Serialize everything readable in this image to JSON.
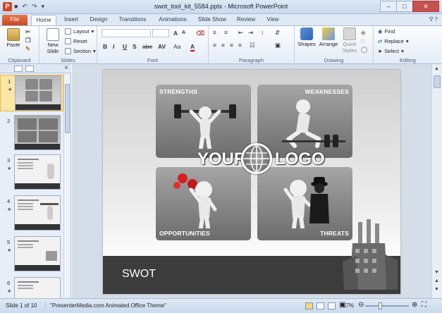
{
  "window": {
    "title": "swot_tool_kit_5584.pptx - Microsoft PowerPoint",
    "app_icon_letter": "P",
    "controls": {
      "minimize": "–",
      "maximize": "□",
      "close": "✕"
    }
  },
  "ribbon_tabs": [
    "File",
    "Home",
    "Insert",
    "Design",
    "Transitions",
    "Animations",
    "Slide Show",
    "Review",
    "View"
  ],
  "active_tab": "Home",
  "ribbon_tab_right": "∇ ?",
  "groups": {
    "clipboard": {
      "label": "Clipboard",
      "paste": "Paste"
    },
    "slides": {
      "label": "Slides",
      "new_slide": "New Slide",
      "layout": "Layout",
      "reset": "Reset",
      "section": "Section"
    },
    "font": {
      "label": "Font",
      "bold": "B",
      "italic": "I",
      "underline": "U",
      "strike": "S",
      "abc": "abe",
      "spacing": "AV",
      "case": "Aa",
      "color": "A",
      "grow": "A",
      "shrink": "A"
    },
    "paragraph": {
      "label": "Paragraph"
    },
    "drawing": {
      "label": "Drawing",
      "shapes": "Shapes",
      "arrange": "Arrange",
      "quick_styles": "Quick Styles"
    },
    "editing": {
      "label": "Editing",
      "find": "Find",
      "replace": "Replace",
      "select": "Select"
    }
  },
  "slide_panel": {
    "thumbnails": [
      {
        "num": "1",
        "selected": true
      },
      {
        "num": "2",
        "selected": false
      },
      {
        "num": "3",
        "selected": false
      },
      {
        "num": "4",
        "selected": false
      },
      {
        "num": "5",
        "selected": false
      },
      {
        "num": "6",
        "selected": false
      }
    ]
  },
  "slide": {
    "strengths": "STRENGTHS",
    "weaknesses": "WEAKNESSES",
    "opportunities": "OPPORTUNITIES",
    "threats": "THREATS",
    "logo_left": "YOUR",
    "logo_right": "LOGO",
    "footer_title": "SWOT"
  },
  "status": {
    "slide_info": "Slide 1 of 10",
    "theme": "\"PresenterMedia.com Animated Office Theme\"",
    "zoom": "67%"
  },
  "colors": {
    "file_tab": "#c64b23",
    "ribbon_border": "#a9bdd6",
    "slide_footer": "#3c3c3c"
  }
}
